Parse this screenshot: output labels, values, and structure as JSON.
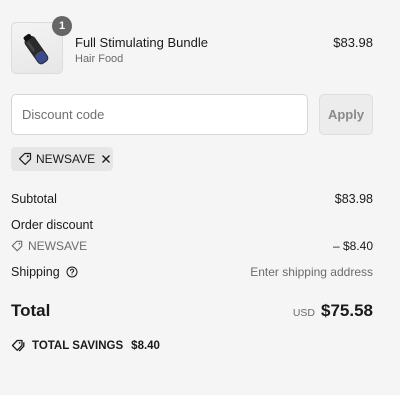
{
  "product": {
    "quantity": "1",
    "name": "Full Stimulating Bundle",
    "variant": "Hair Food",
    "price": "$83.98",
    "image_icon": "bottle-image"
  },
  "discount": {
    "placeholder": "Discount code",
    "value": "",
    "apply_label": "Apply",
    "applied_code": "NEWSAVE",
    "tag_icon": "tag-icon",
    "remove_icon": "close-icon"
  },
  "summary": {
    "subtotal_label": "Subtotal",
    "subtotal_value": "$83.98",
    "order_discount_label": "Order discount",
    "discount_code": "NEWSAVE",
    "discount_value": "– $8.40",
    "shipping_label": "Shipping",
    "shipping_value": "Enter shipping address",
    "help_icon": "help-circle-icon"
  },
  "total": {
    "label": "Total",
    "currency": "USD",
    "amount": "$75.58"
  },
  "savings": {
    "label": "TOTAL SAVINGS",
    "amount": "$8.40",
    "icon": "tag-icon"
  },
  "colors": {
    "background": "#f5f5f5",
    "badge": "#666666",
    "chip": "#e6e6e6",
    "muted_text": "#6b6b6b"
  }
}
